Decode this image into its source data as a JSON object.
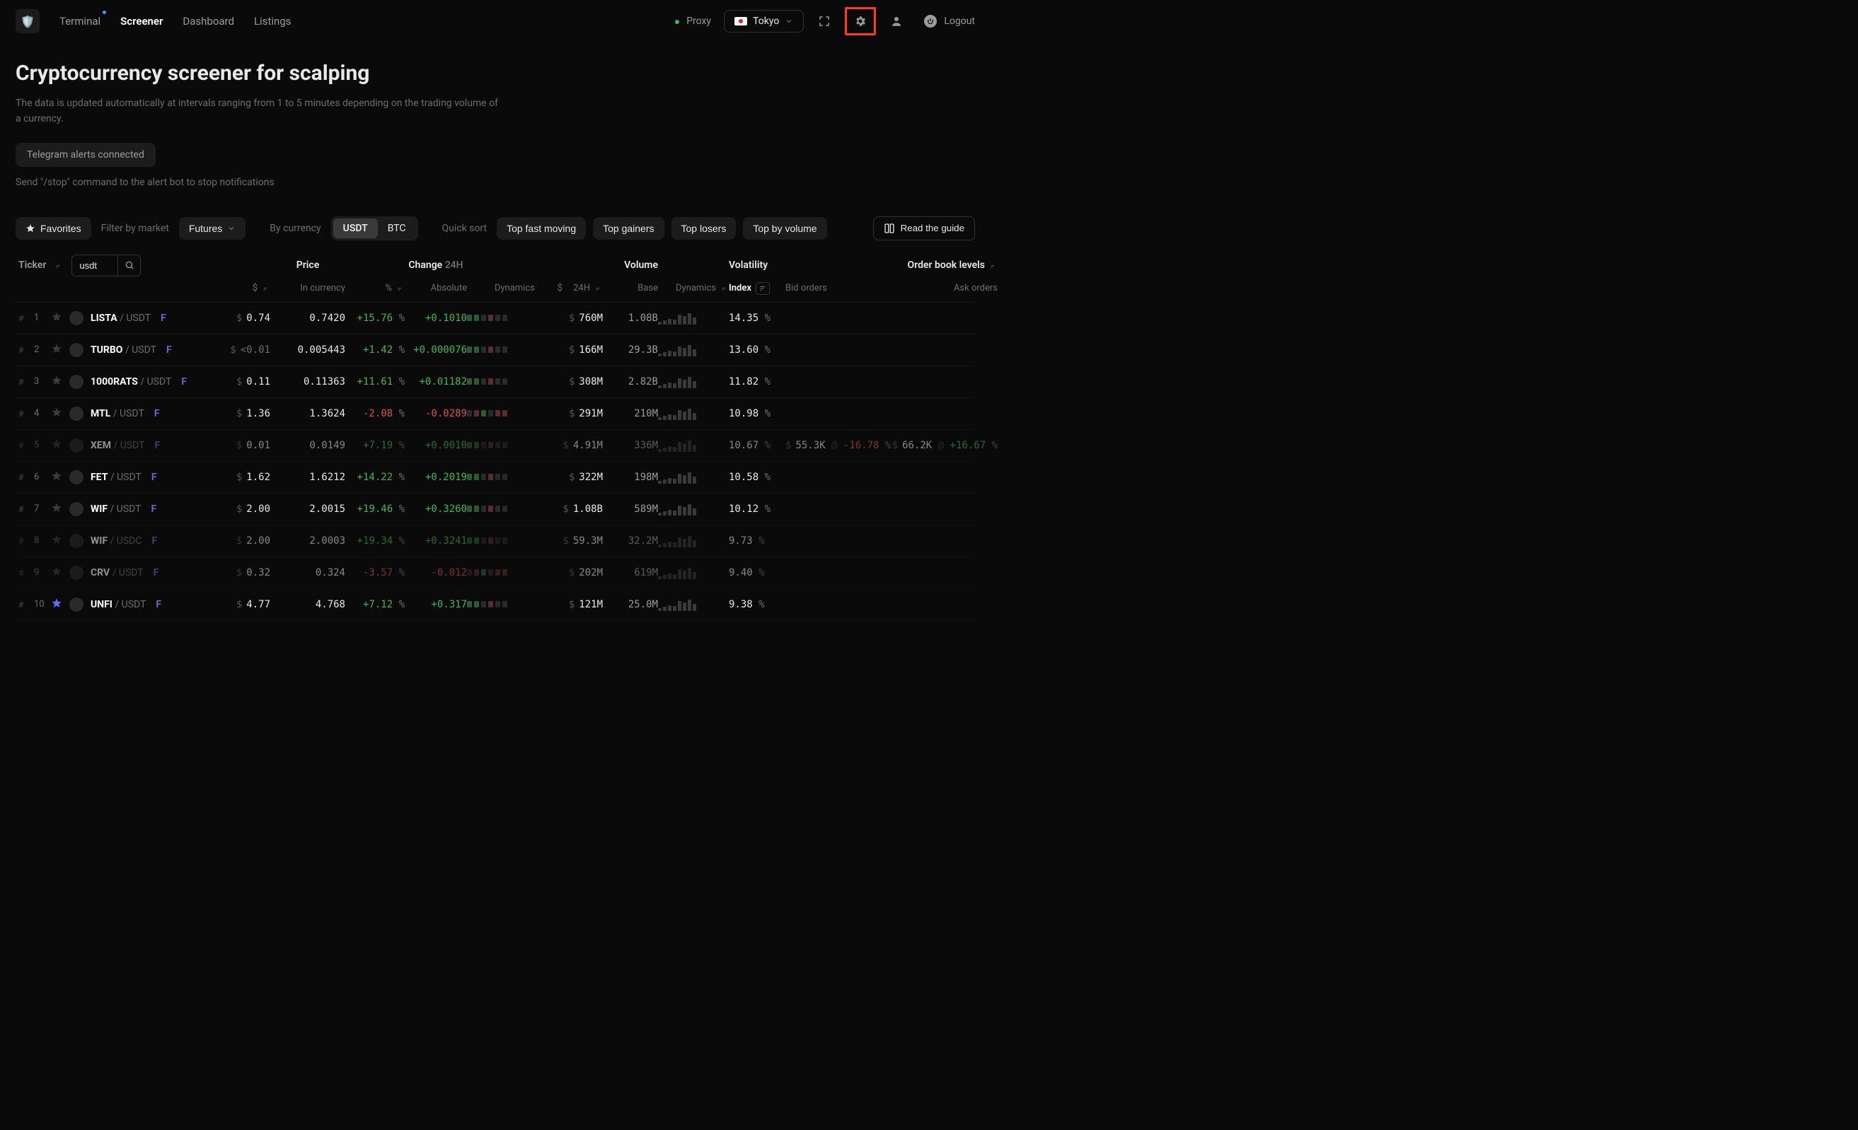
{
  "header": {
    "nav": [
      "Terminal",
      "Screener",
      "Dashboard",
      "Listings"
    ],
    "nav_active": 1,
    "nav_dot_index": 0,
    "proxy_label": "Proxy",
    "location": "Tokyo",
    "logout": "Logout"
  },
  "page": {
    "title": "Cryptocurrency screener for scalping",
    "subtitle": "The data is updated automatically at intervals ranging from 1 to 5 minutes depending on the trading volume of a currency.",
    "telegram_badge": "Telegram alerts connected",
    "stop_hint": "Send \"/stop\" command to the alert bot to stop notifications"
  },
  "toolbar": {
    "favorites": "Favorites",
    "filter_by_market": "Filter by market",
    "market_value": "Futures",
    "by_currency": "By currency",
    "currency_options": [
      "USDT",
      "BTC"
    ],
    "currency_active": 0,
    "quick_sort": "Quick sort",
    "quick_buttons": [
      "Top fast moving",
      "Top gainers",
      "Top losers",
      "Top by volume"
    ],
    "guide": "Read the guide"
  },
  "table": {
    "ticker_label": "Ticker",
    "search_value": "usdt",
    "group_price": "Price",
    "group_change": "Change",
    "group_change_suffix": "24H",
    "group_volume": "Volume",
    "group_volatility": "Volatility",
    "group_orderbook": "Order book levels",
    "col_dollar": "$",
    "col_in_currency": "In currency",
    "col_pct": "%",
    "col_absolute": "Absolute",
    "col_dynamics": "Dynamics",
    "col_vol_dollar": "$",
    "col_vol_24h": "24H",
    "col_base": "Base",
    "col_index": "Index",
    "col_bid": "Bid orders",
    "col_ask": "Ask orders"
  },
  "rows": [
    {
      "n": "1",
      "sym": "LISTA",
      "quote": "USDT",
      "f": "F",
      "pshort": "0.74",
      "pfull": "0.7420",
      "pct": "+15.76",
      "abs": "+0.1010",
      "dir": "up",
      "vol": "760M",
      "base": "1.08B",
      "idx": "14.35",
      "faded": false,
      "star": false
    },
    {
      "n": "2",
      "sym": "TURBO",
      "quote": "USDT",
      "f": "F",
      "pshort": "<0.01",
      "pfull": "0.005443",
      "pct": "+1.42",
      "abs": "+0.000076",
      "dir": "up",
      "vol": "166M",
      "base": "29.3B",
      "idx": "13.60",
      "faded": false,
      "star": false,
      "dimshort": true
    },
    {
      "n": "3",
      "sym": "1000RATS",
      "quote": "USDT",
      "f": "F",
      "pshort": "0.11",
      "pfull": "0.11363",
      "pct": "+11.61",
      "abs": "+0.01182",
      "dir": "up",
      "vol": "308M",
      "base": "2.82B",
      "idx": "11.82",
      "faded": false,
      "star": false
    },
    {
      "n": "4",
      "sym": "MTL",
      "quote": "USDT",
      "f": "F",
      "pshort": "1.36",
      "pfull": "1.3624",
      "pct": "-2.08",
      "abs": "-0.0289",
      "dir": "down",
      "vol": "291M",
      "base": "210M",
      "idx": "10.98",
      "faded": false,
      "star": false
    },
    {
      "n": "5",
      "sym": "XEM",
      "quote": "USDT",
      "f": "F",
      "pshort": "0.01",
      "pfull": "0.0149",
      "pct": "+7.19",
      "abs": "+0.0010",
      "dir": "up",
      "vol": "4.91M",
      "base": "336M",
      "idx": "10.67",
      "faded": true,
      "star": false,
      "bid": {
        "amt": "55.3K",
        "pct": "-16.78"
      },
      "ask": {
        "amt": "66.2K",
        "pct": "+16.67"
      }
    },
    {
      "n": "6",
      "sym": "FET",
      "quote": "USDT",
      "f": "F",
      "pshort": "1.62",
      "pfull": "1.6212",
      "pct": "+14.22",
      "abs": "+0.2019",
      "dir": "up",
      "vol": "322M",
      "base": "198M",
      "idx": "10.58",
      "faded": false,
      "star": false
    },
    {
      "n": "7",
      "sym": "WIF",
      "quote": "USDT",
      "f": "F",
      "pshort": "2.00",
      "pfull": "2.0015",
      "pct": "+19.46",
      "abs": "+0.3260",
      "dir": "up",
      "vol": "1.08B",
      "base": "589M",
      "idx": "10.12",
      "faded": false,
      "star": false
    },
    {
      "n": "8",
      "sym": "WIF",
      "quote": "USDC",
      "f": "F",
      "pshort": "2.00",
      "pfull": "2.0003",
      "pct": "+19.34",
      "abs": "+0.3241",
      "dir": "up",
      "vol": "59.3M",
      "base": "32.2M",
      "idx": "9.73",
      "faded": true,
      "star": false
    },
    {
      "n": "9",
      "sym": "CRV",
      "quote": "USDT",
      "f": "F",
      "pshort": "0.32",
      "pfull": "0.324",
      "pct": "-3.57",
      "abs": "-0.012",
      "dir": "down",
      "vol": "202M",
      "base": "619M",
      "idx": "9.40",
      "faded": true,
      "star": false
    },
    {
      "n": "10",
      "sym": "UNFI",
      "quote": "USDT",
      "f": "F",
      "pshort": "4.77",
      "pfull": "4.768",
      "pct": "+7.12",
      "abs": "+0.317",
      "dir": "up",
      "vol": "121M",
      "base": "25.0M",
      "idx": "9.38",
      "faded": false,
      "star": true
    }
  ]
}
